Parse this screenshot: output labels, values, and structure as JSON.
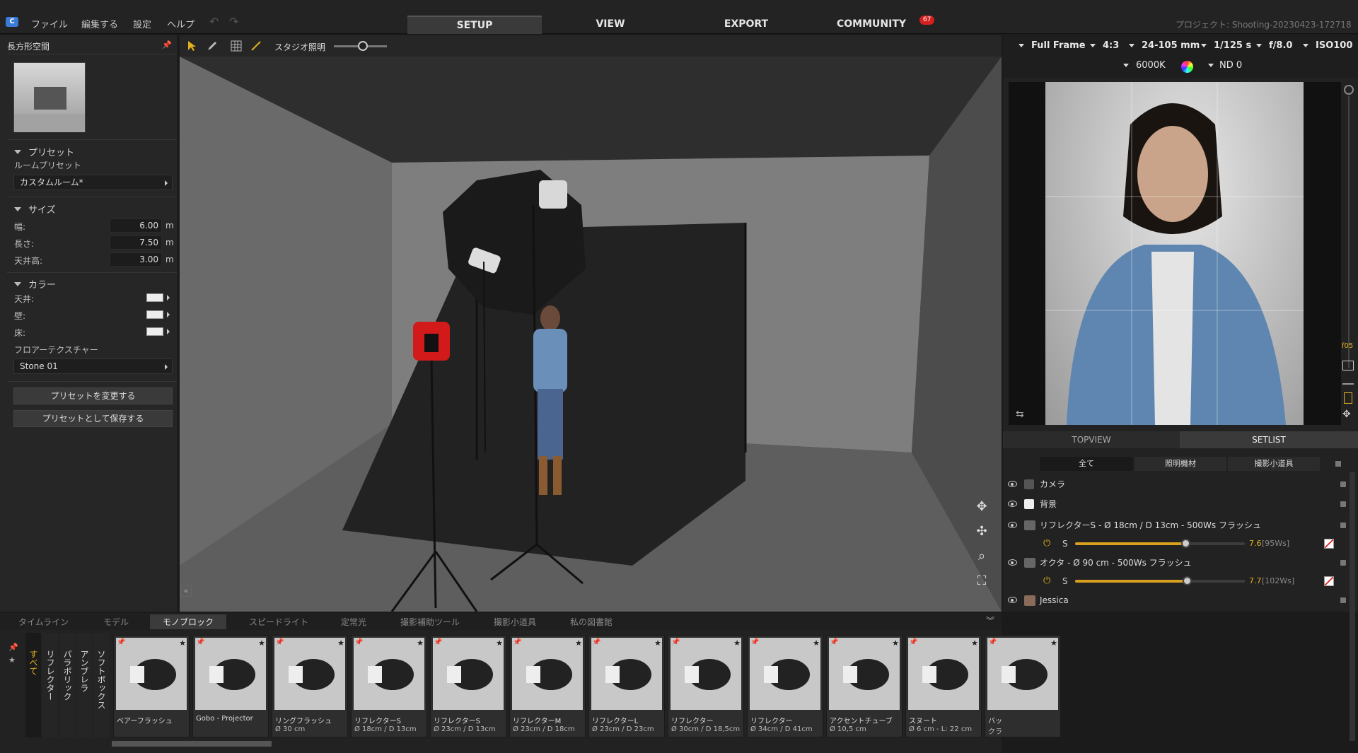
{
  "menu": {
    "logo": "C",
    "items": [
      "ファイル",
      "編集する",
      "設定",
      "ヘルプ"
    ],
    "undo": "↶",
    "redo": "↷"
  },
  "tabs": [
    "SETUP",
    "VIEW",
    "EXPORT",
    "COMMUNITY"
  ],
  "community_badge": "67",
  "project_title": "プロジェクト: Shooting-20230423-172718",
  "left": {
    "title": "長方形空間",
    "presets_header": "プリセット",
    "room_preset_label": "ルームプリセット",
    "room_preset_value": "カスタムルーム*",
    "size_header": "サイズ",
    "width_label": "幅:",
    "width_value": "6.00",
    "length_label": "長さ:",
    "length_value": "7.50",
    "ceiling_label": "天井高:",
    "ceiling_value": "3.00",
    "unit": "m",
    "color_header": "カラー",
    "ceiling_color_label": "天井:",
    "wall_color_label": "壁:",
    "floor_color_label": "床:",
    "floor_texture_label": "フロアーテクスチャー",
    "floor_texture_value": "Stone 01",
    "change_preset_btn": "プリセットを変更する",
    "save_preset_btn": "プリセットとして保存する"
  },
  "viewport_toolbar": {
    "studio_light_label": "スタジオ照明",
    "studio_light_level": 0.55
  },
  "camera": {
    "sensor": "Full Frame",
    "ratio": "4:3",
    "lens": "24-105 mm",
    "shutter": "1/125 s",
    "aperture": "f/8.0",
    "iso": "ISO100",
    "wb": "6000K",
    "nd": "ND 0"
  },
  "preview_side_label": "f05",
  "right_tabs": [
    "TOPVIEW",
    "SETLIST"
  ],
  "setlist_filters": [
    "全て",
    "照明機材",
    "撮影小道具"
  ],
  "setlist": [
    {
      "name": "カメラ"
    },
    {
      "name": "背景"
    },
    {
      "name": "リフレクターS - Ø 18cm / D 13cm - 500Ws フラッシュ",
      "power_label": "S",
      "level": 0.65,
      "value": "7.6",
      "ws": "[95Ws]"
    },
    {
      "name": "オクタ - Ø 90 cm - 500Ws フラッシュ",
      "power_label": "S",
      "level": 0.66,
      "value": "7.7",
      "ws": "[102Ws]"
    },
    {
      "name": "Jessica"
    }
  ],
  "bottom_tabs": [
    "タイムライン",
    "モデル",
    "モノブロック",
    "スピードライト",
    "定常光",
    "撮影補助ツール",
    "撮影小道具",
    "私の図書館"
  ],
  "categories": [
    "すべて",
    "リフレクター",
    "パラボリック",
    "アンブレラ",
    "ソフトボックス"
  ],
  "tiles": [
    {
      "name": "ベアーフラッシュ",
      "sub": ""
    },
    {
      "name": "Gobo - Projector",
      "sub": ""
    },
    {
      "name": "リングフラッシュ",
      "sub": "Ø 30 cm"
    },
    {
      "name": "リフレクターS",
      "sub": "Ø 18cm / D 13cm"
    },
    {
      "name": "リフレクターS",
      "sub": "Ø 23cm / D 13cm"
    },
    {
      "name": "リフレクターM",
      "sub": "Ø 23cm / D 18cm"
    },
    {
      "name": "リフレクターL",
      "sub": "Ø 23cm / D 23cm"
    },
    {
      "name": "リフレクター",
      "sub": "Ø 30cm / D 18,5cm"
    },
    {
      "name": "リフレクター",
      "sub": "Ø 34cm / D 41cm"
    },
    {
      "name": "アクセントチューブ",
      "sub": "Ø 10,5 cm"
    },
    {
      "name": "スヌート",
      "sub": "Ø 6 cm - L: 22 cm"
    },
    {
      "name": "バッ",
      "sub": "クラ"
    }
  ],
  "colors": {
    "accent": "#d9a020",
    "badge": "#d42020",
    "bg": "#1b1b1b"
  }
}
